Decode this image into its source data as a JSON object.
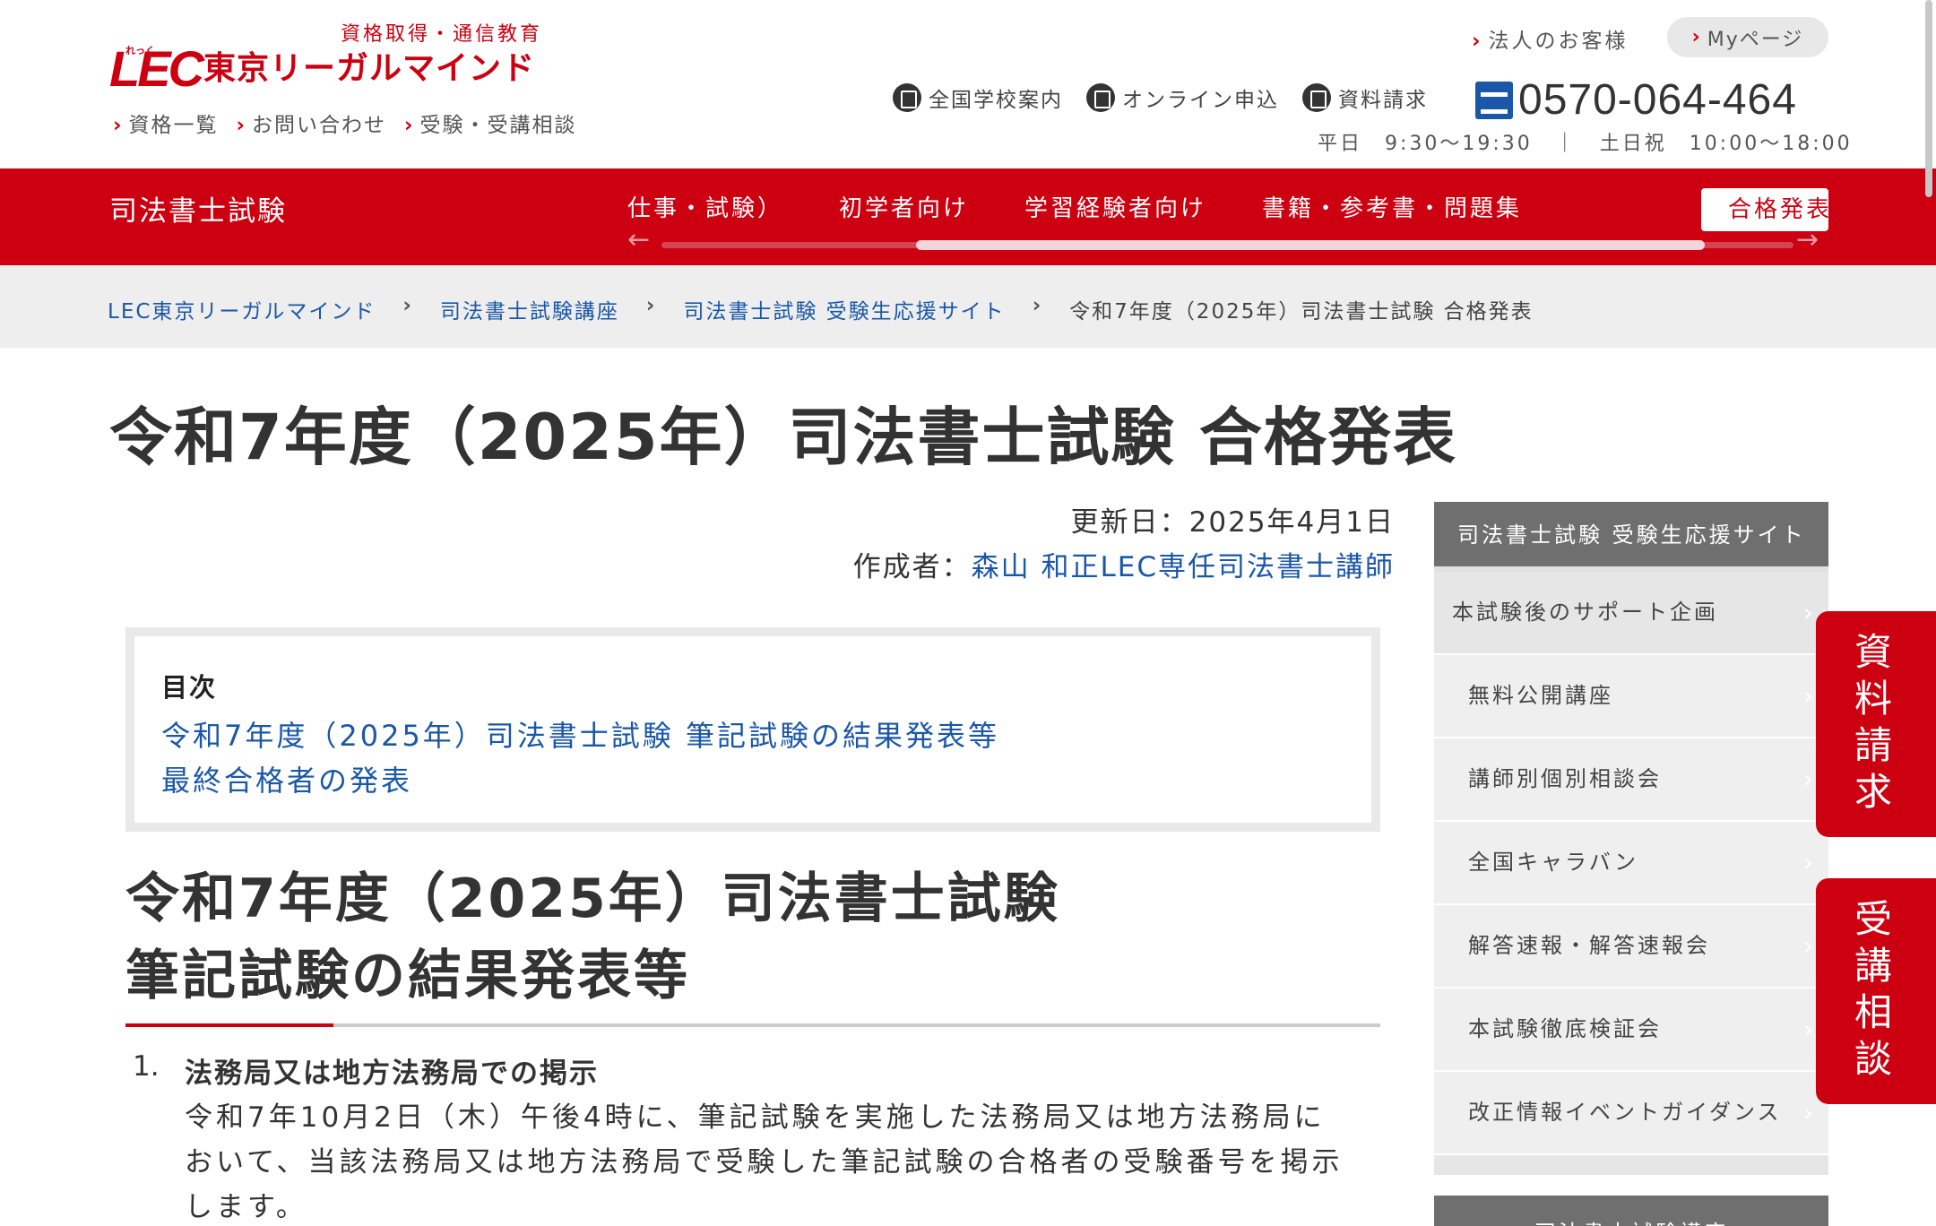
{
  "header": {
    "tagline": "資格取得・通信教育",
    "logo_mark": "LEC",
    "logo_ruby": "れっく",
    "logo_text": "東京リーガルマインド",
    "sublinks": [
      "資格一覧",
      "お問い合わせ",
      "受験・受講相談"
    ],
    "corp_link": "法人のお客様",
    "mypage": "Myページ",
    "utility": [
      "全国学校案内",
      "オンライン申込",
      "資料請求"
    ],
    "phone": "0570-064-464",
    "hours": "平日　9:30〜19:30　｜　土日祝　10:00〜18:00"
  },
  "subnav": {
    "title": "司法書士試験",
    "items": [
      "仕事・試験）",
      "初学者向け",
      "学習経験者向け",
      "書籍・参考書・問題集"
    ],
    "active": "合格発表"
  },
  "breadcrumb": {
    "items": [
      "LEC東京リーガルマインド",
      "司法書士試験講座",
      "司法書士試験 受験生応援サイト"
    ],
    "current": "令和7年度（2025年）司法書士試験 合格発表"
  },
  "page_title": "令和7年度（2025年）司法書士試験 合格発表",
  "meta": {
    "updated": "更新日：2025年4月1日",
    "author_label": "作成者：",
    "author_name": "森山 和正LEC専任司法書士講師"
  },
  "toc": {
    "heading": "目次",
    "links": [
      "令和7年度（2025年）司法書士試験 筆記試験の結果発表等",
      "最終合格者の発表"
    ]
  },
  "section": {
    "title_line1": "令和7年度（2025年）司法書士試験",
    "title_line2": "筆記試験の結果発表等",
    "item_num": "1.",
    "item_head": "法務局又は地方法務局での掲示",
    "item_body": "令和7年10月2日（木）午後4時に、筆記試験を実施した法務局又は地方法務局において、当該法務局又は地方法務局で受験した筆記試験の合格者の受験番号を掲示します。"
  },
  "side_menu": {
    "heading": "司法書士試験 受験生応援サイト",
    "parent": "本試験後のサポート企画",
    "items": [
      "無料公開講座",
      "講師別個別相談会",
      "全国キャラバン",
      "解答速報・解答速報会",
      "本試験徹底検証会",
      "改正情報イベントガイダンス"
    ],
    "next_heading": "司法書士試験講座"
  },
  "float_buttons": {
    "docs": [
      "資",
      "料",
      "請",
      "求"
    ],
    "consult": [
      "受",
      "講",
      "相",
      "談"
    ]
  },
  "colors": {
    "brand_red": "#cc0011",
    "link_blue": "#1b57a7"
  }
}
